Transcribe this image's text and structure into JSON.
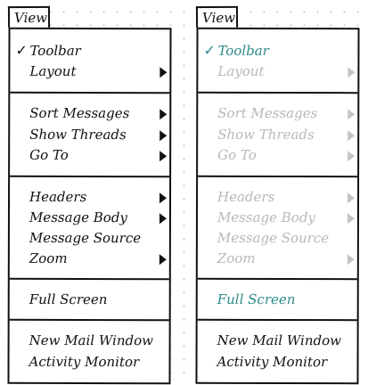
{
  "accent_color": "#2e8b8b",
  "disabled_color": "#b8b8b8",
  "menus": [
    {
      "title": "View",
      "state": "normal",
      "items": [
        {
          "label": "Toolbar",
          "checked": true
        },
        {
          "label": "Layout",
          "submenu": true
        },
        {
          "label": "Sort Messages",
          "submenu": true
        },
        {
          "label": "Show Threads",
          "submenu": true
        },
        {
          "label": "Go To",
          "submenu": true
        },
        {
          "label": "Headers",
          "submenu": true
        },
        {
          "label": "Message Body",
          "submenu": true
        },
        {
          "label": "Message Source"
        },
        {
          "label": "Zoom",
          "submenu": true
        },
        {
          "label": "Full Screen"
        },
        {
          "label": "New Mail Window"
        },
        {
          "label": "Activity Monitor"
        }
      ]
    },
    {
      "title": "View",
      "state": "full-screen-mode",
      "items": [
        {
          "label": "Toolbar",
          "checked": true,
          "highlighted": true
        },
        {
          "label": "Layout",
          "submenu": true,
          "disabled": true
        },
        {
          "label": "Sort Messages",
          "submenu": true,
          "disabled": true
        },
        {
          "label": "Show Threads",
          "submenu": true,
          "disabled": true
        },
        {
          "label": "Go To",
          "submenu": true,
          "disabled": true
        },
        {
          "label": "Headers",
          "submenu": true,
          "disabled": true
        },
        {
          "label": "Message Body",
          "submenu": true,
          "disabled": true
        },
        {
          "label": "Message Source",
          "disabled": true
        },
        {
          "label": "Zoom",
          "submenu": true,
          "disabled": true
        },
        {
          "label": "Full Screen",
          "highlighted": true
        },
        {
          "label": "New Mail Window"
        },
        {
          "label": "Activity Monitor"
        }
      ]
    }
  ]
}
